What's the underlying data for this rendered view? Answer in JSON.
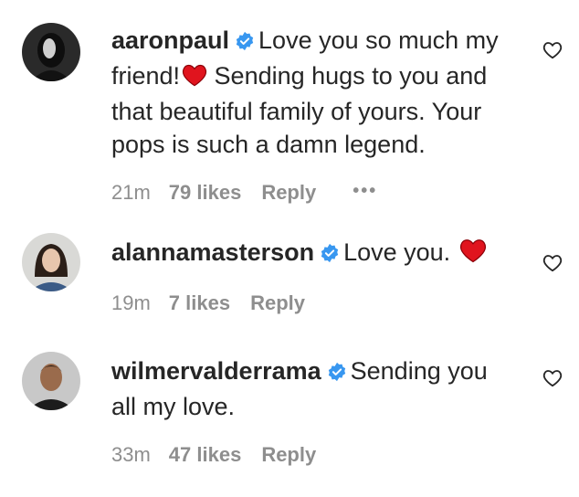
{
  "comments": [
    {
      "username": "aaronpaul",
      "verified": true,
      "text_before_emoji": "Love you so much my friend!",
      "text_after_emoji": " Sending hugs to you and that beautiful family of yours. Your pops is such a damn legend.",
      "time": "21m",
      "likes": "79 likes",
      "reply": "Reply",
      "more": "•••",
      "avatar_icon": "dark-hooded-portrait"
    },
    {
      "username": "alannamasterson",
      "verified": true,
      "text_before_emoji": "Love you.",
      "text_after_emoji": "",
      "time": "19m",
      "likes": "7 likes",
      "reply": "Reply",
      "avatar_icon": "woman-portrait"
    },
    {
      "username": "wilmervalderrama",
      "verified": true,
      "text_before_emoji": "Sending you all my love.",
      "time": "33m",
      "likes": "47 likes",
      "reply": "Reply",
      "avatar_icon": "man-portrait"
    }
  ],
  "colors": {
    "verified_badge": "#3897f0",
    "heart_emoji": "#e0141e",
    "meta_text": "#8e8e8e",
    "main_text": "#262626"
  },
  "icons": {
    "verified": "verified-badge-icon",
    "like": "heart-outline-icon",
    "emoji": "red-heart-emoji"
  }
}
